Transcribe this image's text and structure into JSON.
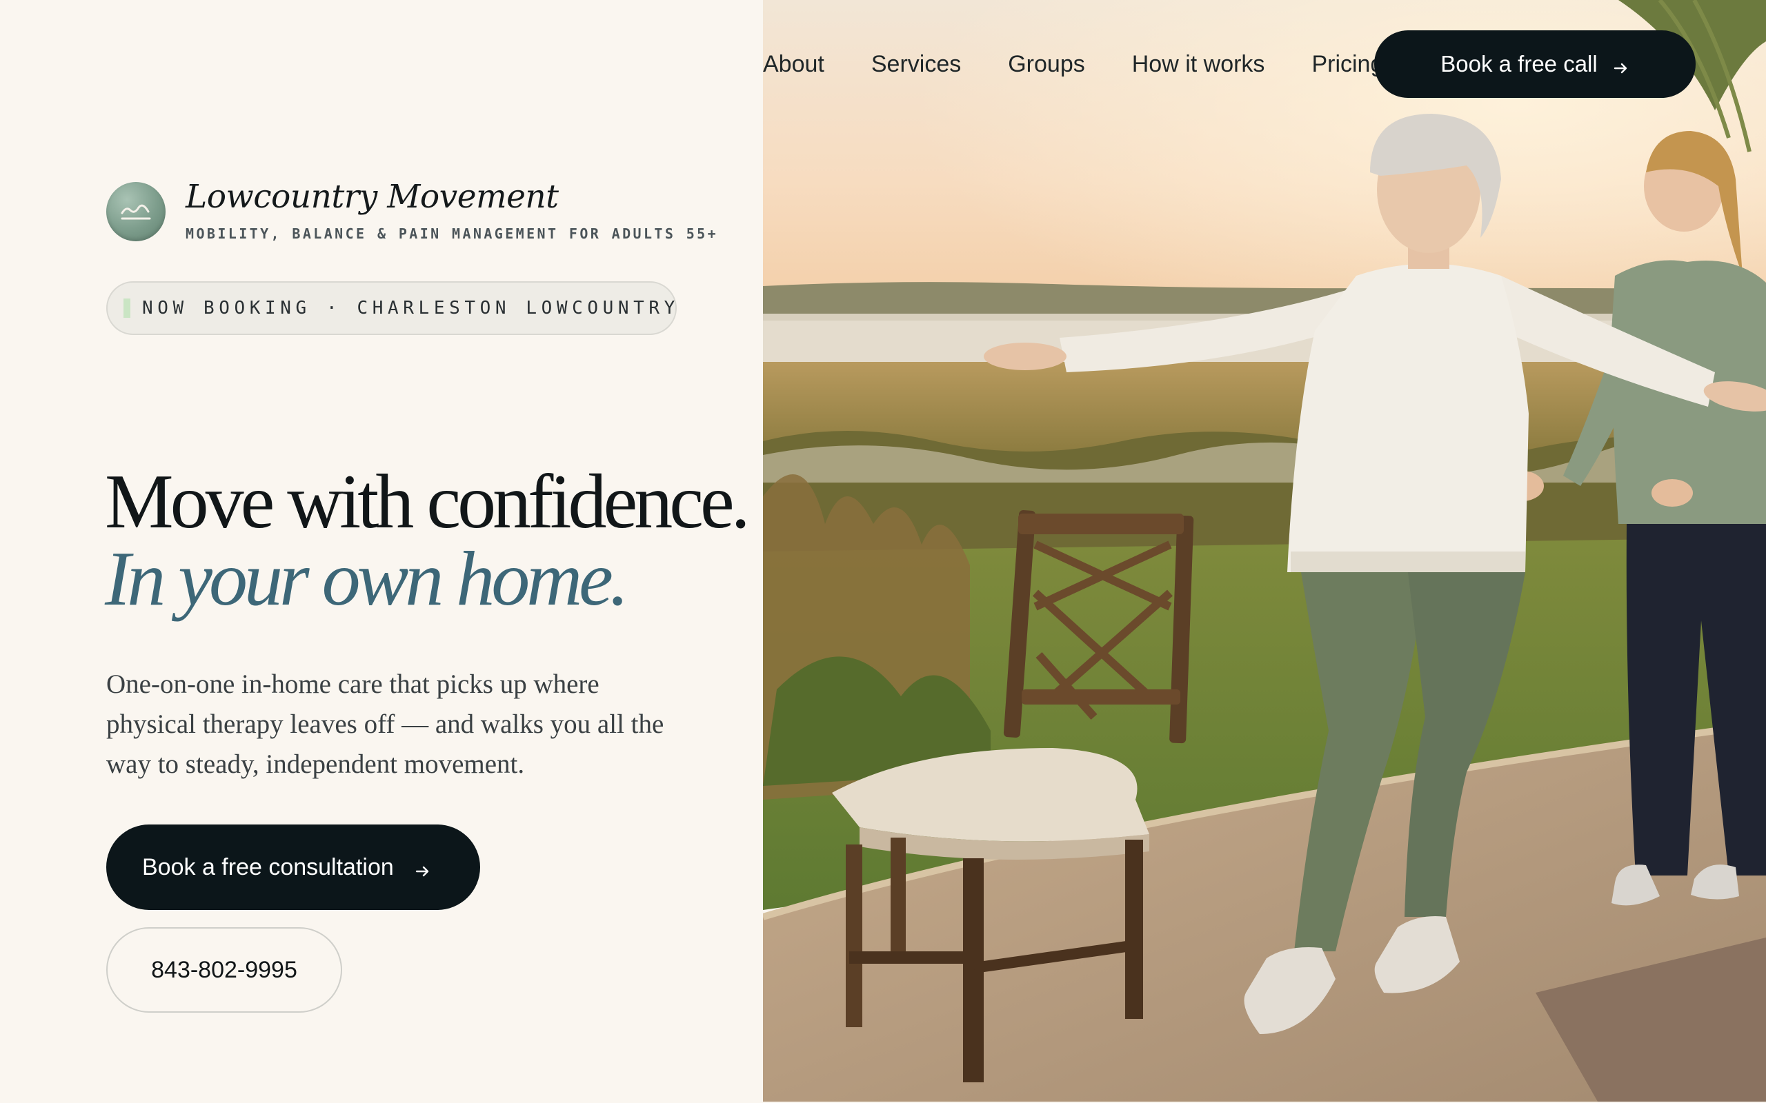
{
  "nav": {
    "links": [
      {
        "label": "About"
      },
      {
        "label": "Services"
      },
      {
        "label": "Groups"
      },
      {
        "label": "How it works"
      },
      {
        "label": "Pricing"
      }
    ],
    "cta_label": "Book a free call",
    "cta_icon": "arrow-right-icon"
  },
  "brand": {
    "name": "Lowcountry Movement",
    "tagline": "MOBILITY, BALANCE & PAIN MANAGEMENT FOR ADULTS 55+",
    "logo_icon": "horizon-mountain-icon"
  },
  "status": {
    "text": "NOW BOOKING · CHARLESTON LOWCOUNTRY",
    "dot_color": "#6fd46a"
  },
  "hero": {
    "headline_line1": "Move with confidence.",
    "headline_line2": "In your own home.",
    "lead": "One-on-one in-home care that picks up where physical therapy leaves off — and walks you all the way to steady, independent movement.",
    "primary_cta": "Book a free consultation",
    "phone": "843-802-9995",
    "image_alt": "Older woman practicing a balance walk with arms extended beside a wooden chair on a patio overlooking the marsh, with a trainer behind her"
  },
  "colors": {
    "background": "#faf6f0",
    "ink": "#0c161a",
    "accent_teal": "#3d6778",
    "logo_green": "#7c9c8b"
  }
}
